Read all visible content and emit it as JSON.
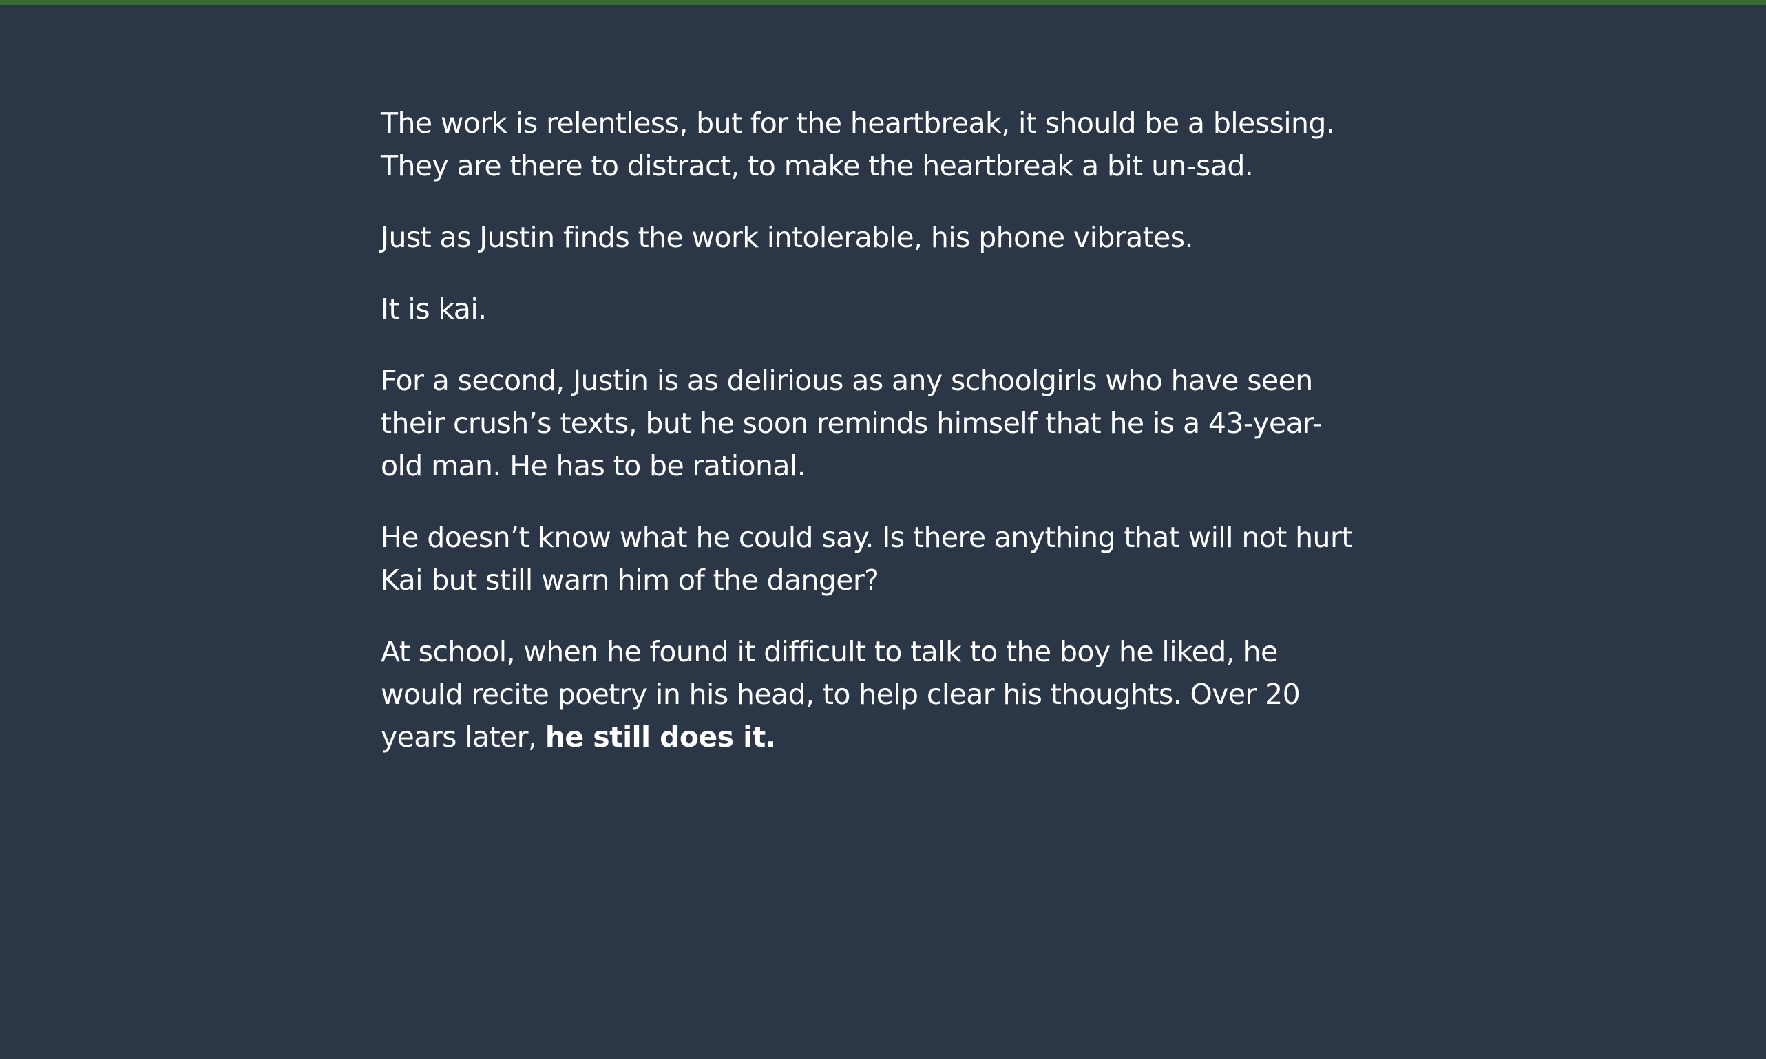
{
  "story": {
    "paragraphs": [
      "The work is relentless, but for the heartbreak, it should be a blessing. They are there to distract, to make the heartbreak a bit un-sad.",
      "Just as Justin finds the work intolerable, his phone vibrates.",
      "It is kai.",
      "For a second, Justin is as delirious as any schoolgirls who have seen their crush’s texts, but he soon reminds himself that he is a 43-year-old man. He has to be rational.",
      "He doesn’t know what he could say. Is there anything that will not hurt Kai but still warn him of the danger?"
    ],
    "final_paragraph": {
      "text": "At school, when he found it difficult to talk to the boy he liked, he would recite poetry in his head, to help clear his thoughts. Over 20 years later, ",
      "emphasis": "he still does it."
    }
  },
  "colors": {
    "background": "#2b3646",
    "top_bar": "#3a6b35",
    "text": "#ffffff"
  }
}
